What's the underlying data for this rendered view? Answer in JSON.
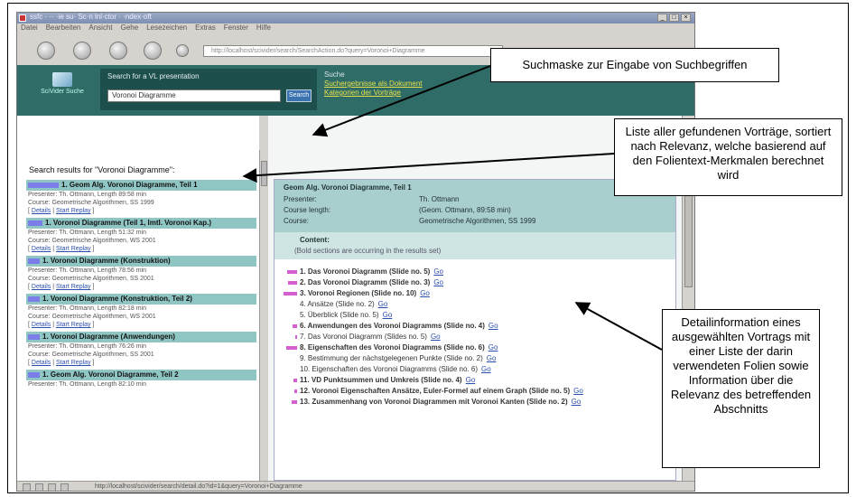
{
  "window": {
    "title": "ssfc · ·· ·ie su· Sc·n lnl·ctor · ·ndex·oft",
    "controls": [
      "_",
      "□",
      "×"
    ]
  },
  "menu": [
    "Datei",
    "Bearbeiten",
    "Ansicht",
    "Gehe",
    "Lesezeichen",
    "Extras",
    "Fenster",
    "Hilfe"
  ],
  "address_bar": "http://localhost/scivider/search/SearchAction.do?query=Voronoi+Diagramme",
  "header": {
    "logo_text": "SciVider Suche",
    "search_label": "Search for a VL presentation",
    "search_value": "Voronoi Diagramme",
    "search_button": "Search",
    "links": {
      "plain": "Suche",
      "link1": "Suchergebnisse als Dokument",
      "link2": "Kategorien der Vorträge"
    }
  },
  "results": {
    "title": "Search results for \"Voronoi Diagramme\":",
    "items": [
      {
        "title": "1. Geom Alg. Voronoi Diagramme, Teil 1",
        "meta1": "Presenter: Th. Ottmann, Length 89:58 min",
        "meta2": "Course: Geometrische Algorithmen, SS 1999",
        "links": [
          "Details",
          "Start Replay"
        ],
        "relevance": 0.33
      },
      {
        "title": "1. Voronoi Diagramme (Teil 1, lmtl. Voronoi Kap.)",
        "meta1": "Presenter: Th. Ottmann, Length 51:32 min",
        "meta2": "Course: Geometrische Algorithmen, WS 2001",
        "links": [
          "Details",
          "Start Replay"
        ],
        "relevance": 0.1
      },
      {
        "title": "1. Voronoi Diagramme (Konstruktion)",
        "meta1": "Presenter: Th. Ottmann, Length 78:56 min",
        "meta2": "Course: Geometrische Algorithmen, SS 2001",
        "links": [
          "Details",
          "Start Replay"
        ],
        "relevance": 0.06
      },
      {
        "title": "1. Voronoi Diagramme (Konstruktion, Teil 2)",
        "meta1": "Presenter: Th. Ottmann, Length 82:18 min",
        "meta2": "Course: Geometrische Algorithmen, WS 2001",
        "links": [
          "Details",
          "Start Replay"
        ],
        "relevance": 0.06
      },
      {
        "title": "1. Voronoi Diagramme (Anwendungen)",
        "meta1": "Presenter: Th. Ottmann, Length 76:26 min",
        "meta2": "Course: Geometrische Algorithmen, SS 2001",
        "links": [
          "Details",
          "Start Replay"
        ],
        "relevance": 0.06
      },
      {
        "title": "1. Geom Alg. Voronoi Diagramme, Teil 2",
        "meta1": "Presenter: Th. Ottmann, Length 82:10 min",
        "meta2": "",
        "links": [],
        "relevance": 0.06
      }
    ]
  },
  "detail": {
    "title": "Geom Alg. Voronoi Diagramme, Teil 1",
    "rows": [
      {
        "label": "Presenter:",
        "value": "Th. Ottmann"
      },
      {
        "label": "Course length:",
        "value": "(Geom. Ottmann, 89:58 min)"
      },
      {
        "label": "Course:",
        "value": "Geometrische Algorithmen, SS 1999"
      }
    ],
    "content_title": "Content:",
    "content_note": "(Bold sections are occurring in the results set)",
    "sections": [
      {
        "text": "1. Das Voronoi Diagramm (Slide no. 5)",
        "link": "Go",
        "bold": true,
        "relevance": 0.55
      },
      {
        "text": "2. Das Voronoi Diagramm (Slide no. 3)",
        "link": "Go",
        "bold": true,
        "relevance": 0.5
      },
      {
        "text": "3. Voronoi Regionen (Slide no. 10)",
        "link": "Go",
        "bold": true,
        "relevance": 0.75
      },
      {
        "text": "4. Ansätze (Slide no. 2)",
        "link": "Go",
        "bold": false,
        "relevance": 0.0
      },
      {
        "text": "5. Überblick (Slide no. 5)",
        "link": "Go",
        "bold": false,
        "relevance": 0.0
      },
      {
        "text": "6. Anwendungen des Voronoi Diagramms (Slide no. 4)",
        "link": "Go",
        "bold": true,
        "relevance": 0.25
      },
      {
        "text": "7. Das Voronoi Diagramm (Slides no. 5)",
        "link": "Go",
        "bold": false,
        "relevance": 0.12
      },
      {
        "text": "8. Eigenschaften des Voronoi Diagramms (Slide no. 6)",
        "link": "Go",
        "bold": true,
        "relevance": 0.6
      },
      {
        "text": "9. Bestimmung der nächstgelegenen Punkte (Slide no. 2)",
        "link": "Go",
        "bold": false,
        "relevance": 0.0
      },
      {
        "text": "10. Eigenschaften des Voronoi Diagramms (Slide no. 6)",
        "link": "Go",
        "bold": false,
        "relevance": 0.0
      },
      {
        "text": "11. VD Punktsummen und Umkreis (Slide no. 4)",
        "link": "Go",
        "bold": true,
        "relevance": 0.22
      },
      {
        "text": "12. Voronoi Eigenschaften Ansätze, Euler-Formel auf einem Graph (Slide no. 5)",
        "link": "Go",
        "bold": true,
        "relevance": 0.15
      },
      {
        "text": "13. Zusammenhang von Voronoi Diagrammen mit Voronoi Kanten (Slide no. 2)",
        "link": "Go",
        "bold": true,
        "relevance": 0.3
      }
    ]
  },
  "status": "http://localhost/scivider/search/detail.do?id=1&query=Voronoi+Diagramme",
  "callouts": {
    "search": "Suchmaske zur Eingabe von Suchbegriffen",
    "list": "Liste aller gefundenen Vorträge, sortiert nach Relevanz, welche basierend auf den Folientext-Merkmalen berechnet wird",
    "detail": "Detailinformation eines ausgewählten Vortrags mit einer Liste der darin verwendeten Folien sowie Information über die Relevanz des betreffenden Abschnitts"
  }
}
